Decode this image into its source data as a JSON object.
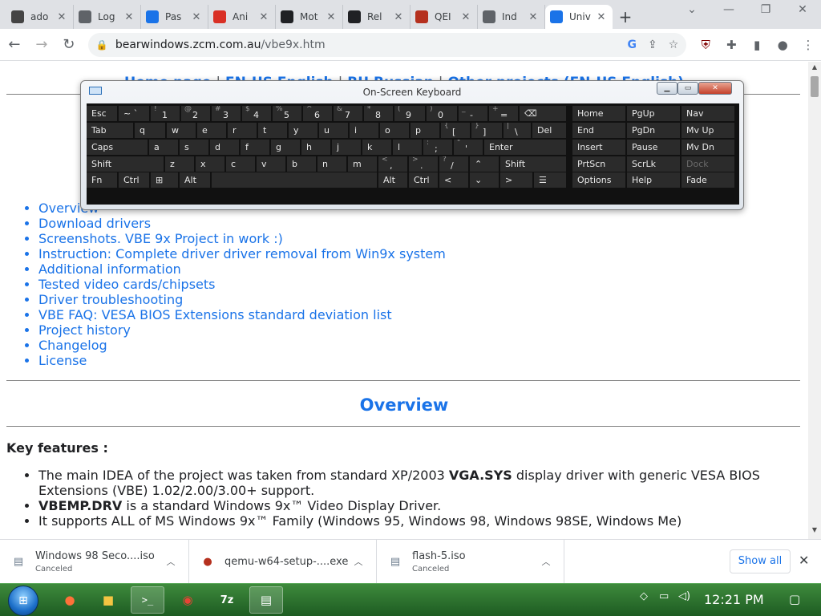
{
  "browser": {
    "tabs": [
      {
        "title": "ado",
        "favicon": "document-icon",
        "color": "#444444"
      },
      {
        "title": "Log",
        "favicon": "globe-icon",
        "color": "#5f6368"
      },
      {
        "title": "Pas",
        "favicon": "key-icon",
        "color": "#1a73e8"
      },
      {
        "title": "Ani",
        "favicon": "flash-icon",
        "color": "#d93025"
      },
      {
        "title": "Mot",
        "favicon": "monitor-icon",
        "color": "#202124"
      },
      {
        "title": "Rel",
        "favicon": "github-icon",
        "color": "#202124"
      },
      {
        "title": "QEI",
        "favicon": "qemu-icon",
        "color": "#b5301e"
      },
      {
        "title": "Ind",
        "favicon": "archive-icon",
        "color": "#5f6368"
      },
      {
        "title": "Univ",
        "favicon": "vbe-logo-icon",
        "color": "#1a73e8"
      }
    ],
    "active_tab": 8,
    "url_host": "bearwindows.zcm.com.au",
    "url_path": "/vbe9x.htm"
  },
  "page": {
    "topnav": {
      "home": "Home page",
      "sep": "|",
      "en": "EN-US English",
      "ru": "RU Russian",
      "other": "Other projects (EN-US English)"
    },
    "toc": [
      "Overview",
      "Download drivers",
      "Screenshots. VBE 9x Project in work :)",
      "Instruction: Complete driver driver removal from Win9x system",
      "Additional information",
      "Tested video cards/chipsets",
      "Driver troubleshooting",
      "VBE FAQ: VESA BIOS Extensions standard deviation list",
      "Project history",
      "Changelog",
      "License"
    ],
    "overview_heading": "Overview",
    "key_features_title": "Key features :",
    "features": [
      {
        "pre": "The main IDEA of the project was taken from standard XP/2003 ",
        "bold": "VGA.SYS",
        "post": " display driver with generic VESA BIOS Extensions (VBE) 1.02/2.00/3.00+ support."
      },
      {
        "pre": "",
        "bold": "VBEMP.DRV",
        "post": " is a standard Windows 9x™ Video Display Driver."
      },
      {
        "pre": "It supports ALL of MS Windows 9x™ Family (Windows 95, Windows 98, Windows 98SE, Windows Me)",
        "bold": "",
        "post": ""
      }
    ]
  },
  "osk": {
    "title": "On-Screen Keyboard",
    "rows": [
      [
        {
          "main": "Esc",
          "top": ""
        },
        {
          "main": "~ `",
          "top": ""
        },
        {
          "main": "1",
          "top": "!"
        },
        {
          "main": "2",
          "top": "@"
        },
        {
          "main": "3",
          "top": "#"
        },
        {
          "main": "4",
          "top": "$"
        },
        {
          "main": "5",
          "top": "%"
        },
        {
          "main": "6",
          "top": "^"
        },
        {
          "main": "7",
          "top": "&"
        },
        {
          "main": "8",
          "top": "*"
        },
        {
          "main": "9",
          "top": "("
        },
        {
          "main": "0",
          "top": ")"
        },
        {
          "main": "-",
          "top": "_"
        },
        {
          "main": "=",
          "top": "+"
        },
        {
          "main": "⌫",
          "top": ""
        }
      ],
      [
        {
          "main": "Tab",
          "top": ""
        },
        {
          "main": "q",
          "top": ""
        },
        {
          "main": "w",
          "top": ""
        },
        {
          "main": "e",
          "top": ""
        },
        {
          "main": "r",
          "top": ""
        },
        {
          "main": "t",
          "top": ""
        },
        {
          "main": "y",
          "top": ""
        },
        {
          "main": "u",
          "top": ""
        },
        {
          "main": "i",
          "top": ""
        },
        {
          "main": "o",
          "top": ""
        },
        {
          "main": "p",
          "top": ""
        },
        {
          "main": "[",
          "top": "{"
        },
        {
          "main": "]",
          "top": "}"
        },
        {
          "main": "\\",
          "top": "|"
        },
        {
          "main": "Del",
          "top": ""
        }
      ],
      [
        {
          "main": "Caps",
          "top": ""
        },
        {
          "main": "a",
          "top": ""
        },
        {
          "main": "s",
          "top": ""
        },
        {
          "main": "d",
          "top": ""
        },
        {
          "main": "f",
          "top": ""
        },
        {
          "main": "g",
          "top": ""
        },
        {
          "main": "h",
          "top": ""
        },
        {
          "main": "j",
          "top": ""
        },
        {
          "main": "k",
          "top": ""
        },
        {
          "main": "l",
          "top": ""
        },
        {
          "main": ";",
          "top": ":"
        },
        {
          "main": "'",
          "top": "\""
        },
        {
          "main": "Enter",
          "top": ""
        }
      ],
      [
        {
          "main": "Shift",
          "top": ""
        },
        {
          "main": "z",
          "top": ""
        },
        {
          "main": "x",
          "top": ""
        },
        {
          "main": "c",
          "top": ""
        },
        {
          "main": "v",
          "top": ""
        },
        {
          "main": "b",
          "top": ""
        },
        {
          "main": "n",
          "top": ""
        },
        {
          "main": "m",
          "top": ""
        },
        {
          "main": ",",
          "top": "<"
        },
        {
          "main": ".",
          "top": ">"
        },
        {
          "main": "/",
          "top": "?"
        },
        {
          "main": "⌃",
          "top": ""
        },
        {
          "main": "Shift",
          "top": ""
        }
      ],
      [
        {
          "main": "Fn",
          "top": ""
        },
        {
          "main": "Ctrl",
          "top": ""
        },
        {
          "main": "⊞",
          "top": ""
        },
        {
          "main": "Alt",
          "top": ""
        },
        {
          "main": "",
          "top": ""
        },
        {
          "main": "Alt",
          "top": ""
        },
        {
          "main": "Ctrl",
          "top": ""
        },
        {
          "main": "<",
          "top": ""
        },
        {
          "main": "⌄",
          "top": ""
        },
        {
          "main": ">",
          "top": ""
        },
        {
          "main": "☰",
          "top": ""
        }
      ]
    ],
    "nav_rows": [
      [
        "Home",
        "PgUp",
        "Nav"
      ],
      [
        "End",
        "PgDn",
        "Mv Up"
      ],
      [
        "Insert",
        "Pause",
        "Mv Dn"
      ],
      [
        "PrtScn",
        "ScrLk",
        "Dock"
      ],
      [
        "Options",
        "Help",
        "Fade"
      ]
    ]
  },
  "downloads": [
    {
      "name": "Windows 98 Seco....iso",
      "status": "Canceled",
      "icon": "disc-file-icon"
    },
    {
      "name": "qemu-w64-setup-....exe",
      "status": "",
      "icon": "qemu-icon"
    },
    {
      "name": "flash-5.iso",
      "status": "Canceled",
      "icon": "disc-file-icon"
    }
  ],
  "download_bar": {
    "show_all": "Show all"
  },
  "taskbar": {
    "clock": "12:21 PM",
    "apps": [
      "firefox-icon",
      "explorer-icon",
      "cmd-icon",
      "chrome-icon",
      "7zip-icon",
      "network-app-icon"
    ]
  },
  "colors": {
    "link": "#1a73e8",
    "taskbar": "#2f7a33",
    "osk_key": "#2b2b2b"
  }
}
